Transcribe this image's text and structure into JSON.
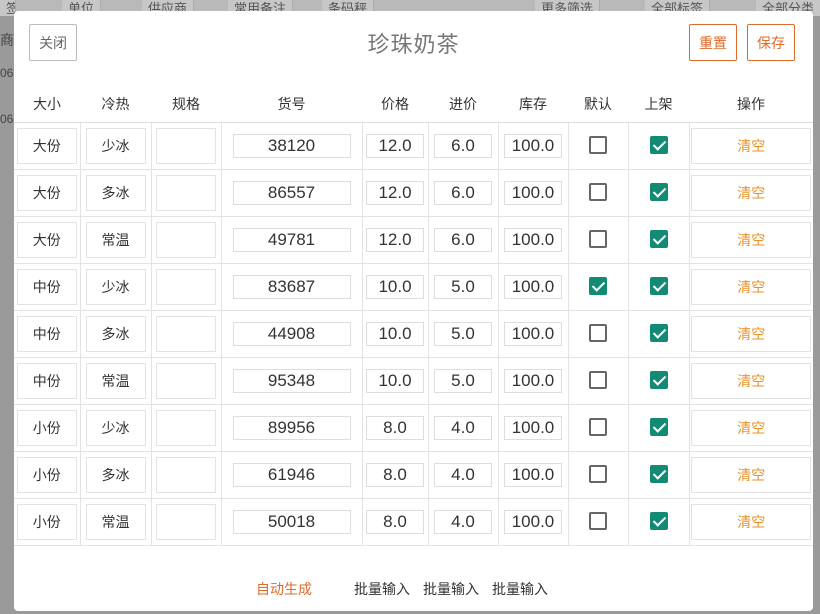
{
  "background": {
    "tabs": [
      "签",
      "单位",
      "供应商",
      "常用备注",
      "条码秤",
      "更多筛选",
      "全部标签",
      "全部分类"
    ],
    "left_fragments": [
      "商",
      "06",
      "06"
    ]
  },
  "modal": {
    "title": "珍珠奶茶",
    "close_label": "关闭",
    "reset_label": "重置",
    "save_label": "保存"
  },
  "table": {
    "headers": [
      "大小",
      "冷热",
      "规格",
      "货号",
      "价格",
      "进价",
      "库存",
      "默认",
      "上架",
      "操作"
    ],
    "rows": [
      {
        "size": "大份",
        "temp": "少冰",
        "spec": "",
        "code": "38120",
        "price": "12.0",
        "cost": "6.0",
        "stock": "100.0",
        "default": false,
        "listed": true,
        "action": "清空"
      },
      {
        "size": "大份",
        "temp": "多冰",
        "spec": "",
        "code": "86557",
        "price": "12.0",
        "cost": "6.0",
        "stock": "100.0",
        "default": false,
        "listed": true,
        "action": "清空"
      },
      {
        "size": "大份",
        "temp": "常温",
        "spec": "",
        "code": "49781",
        "price": "12.0",
        "cost": "6.0",
        "stock": "100.0",
        "default": false,
        "listed": true,
        "action": "清空"
      },
      {
        "size": "中份",
        "temp": "少冰",
        "spec": "",
        "code": "83687",
        "price": "10.0",
        "cost": "5.0",
        "stock": "100.0",
        "default": true,
        "listed": true,
        "action": "清空"
      },
      {
        "size": "中份",
        "temp": "多冰",
        "spec": "",
        "code": "44908",
        "price": "10.0",
        "cost": "5.0",
        "stock": "100.0",
        "default": false,
        "listed": true,
        "action": "清空"
      },
      {
        "size": "中份",
        "temp": "常温",
        "spec": "",
        "code": "95348",
        "price": "10.0",
        "cost": "5.0",
        "stock": "100.0",
        "default": false,
        "listed": true,
        "action": "清空"
      },
      {
        "size": "小份",
        "temp": "少冰",
        "spec": "",
        "code": "89956",
        "price": "8.0",
        "cost": "4.0",
        "stock": "100.0",
        "default": false,
        "listed": true,
        "action": "清空"
      },
      {
        "size": "小份",
        "temp": "多冰",
        "spec": "",
        "code": "61946",
        "price": "8.0",
        "cost": "4.0",
        "stock": "100.0",
        "default": false,
        "listed": true,
        "action": "清空"
      },
      {
        "size": "小份",
        "temp": "常温",
        "spec": "",
        "code": "50018",
        "price": "8.0",
        "cost": "4.0",
        "stock": "100.0",
        "default": false,
        "listed": true,
        "action": "清空"
      }
    ]
  },
  "footer": {
    "auto_generate": "自动生成",
    "batch_price": "批量输入",
    "batch_cost": "批量输入",
    "batch_stock": "批量输入"
  },
  "colors": {
    "accent": "#e06a2a",
    "action": "#e8922a",
    "checked": "#138a74"
  }
}
